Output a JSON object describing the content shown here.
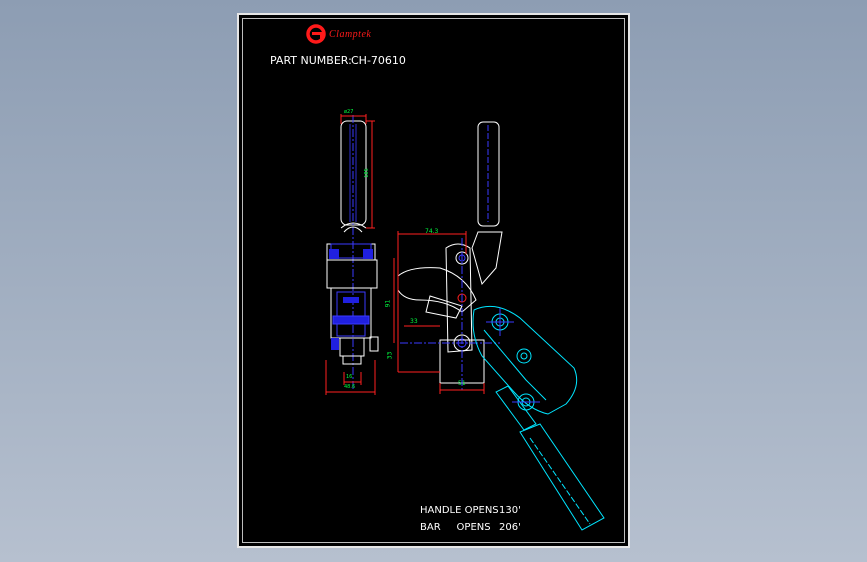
{
  "drawing": {
    "brand": "Clamptek",
    "part_number_label": "PART NUMBER:",
    "part_number": "CH-70610",
    "handle_opens_label": "HANDLE OPENS",
    "handle_opens_value": "130'",
    "bar_opens_label": "BAR     OPENS",
    "bar_opens_value": "206'"
  },
  "dimensions": {
    "handle_dia": "ø27",
    "handle_len": "185",
    "width_a": "74.3",
    "height_a": "91",
    "width_b": "33",
    "height_b": "33",
    "width_c": "51",
    "base_a": "16",
    "base_b": "48.6"
  },
  "colors": {
    "background": "#000000",
    "outline": "#ffffff",
    "dimension": "#ff2020",
    "centerline": "#3a3aff",
    "dimension_text": "#00ff40",
    "open_position": "#00e5ff",
    "brand": "#ff1a1a"
  }
}
